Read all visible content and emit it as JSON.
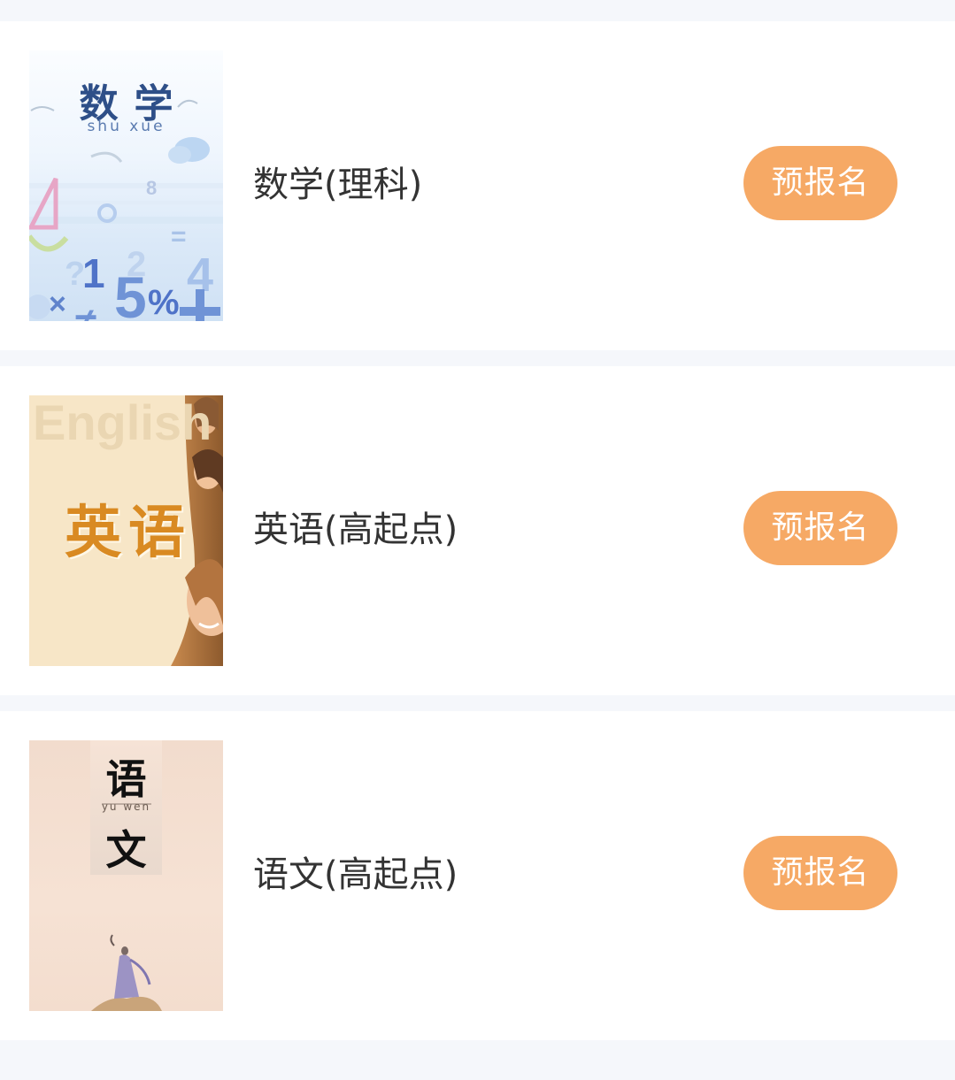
{
  "courses": [
    {
      "title": "数学(理科)",
      "button_label": "预报名",
      "cover": {
        "title": "数学",
        "pinyin": "shu xue",
        "theme": "math"
      }
    },
    {
      "title": "英语(高起点)",
      "button_label": "预报名",
      "cover": {
        "title": "英语",
        "word": "English",
        "theme": "english"
      }
    },
    {
      "title": "语文(高起点)",
      "button_label": "预报名",
      "cover": {
        "title_top": "语",
        "pinyin": "yu wen",
        "title_bottom": "文",
        "theme": "chinese"
      }
    }
  ],
  "colors": {
    "page_background": "#f5f7fb",
    "card_background": "#ffffff",
    "button_background": "#f6a965",
    "button_text": "#ffffff",
    "title_text": "#333333"
  }
}
